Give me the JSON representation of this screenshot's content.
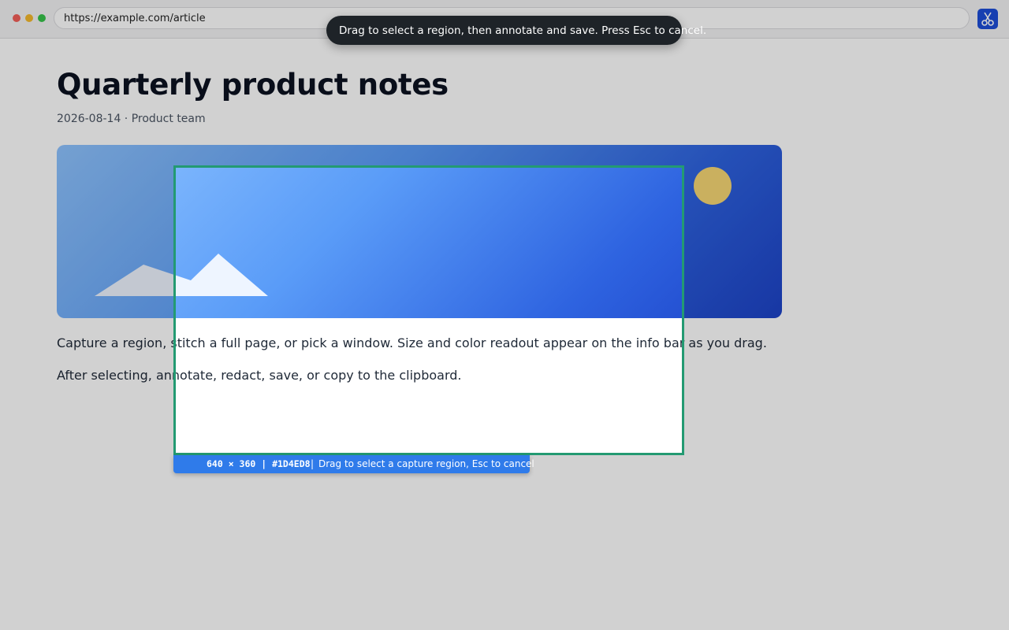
{
  "browser": {
    "url": "https://example.com/article",
    "extension_icon": "scissors-icon"
  },
  "article": {
    "title": "Quarterly product notes",
    "meta": "2026-08-14 · Product team",
    "paragraphs": [
      "Capture a region, stitch a full page, or pick a window. Size and color readout appear on the info bar as you drag.",
      "After selecting, annotate, redact, save, or copy to the clipboard."
    ]
  },
  "capture": {
    "toast": "Drag to select a region, then annotate and save. Press Esc to cancel.",
    "size_color": "640 × 360 | #1D4ED8",
    "separator": "|",
    "hint": "Drag to select a capture region, Esc to cancel",
    "accent_color": "#239a72",
    "infobar_color": "#2f7bea"
  }
}
